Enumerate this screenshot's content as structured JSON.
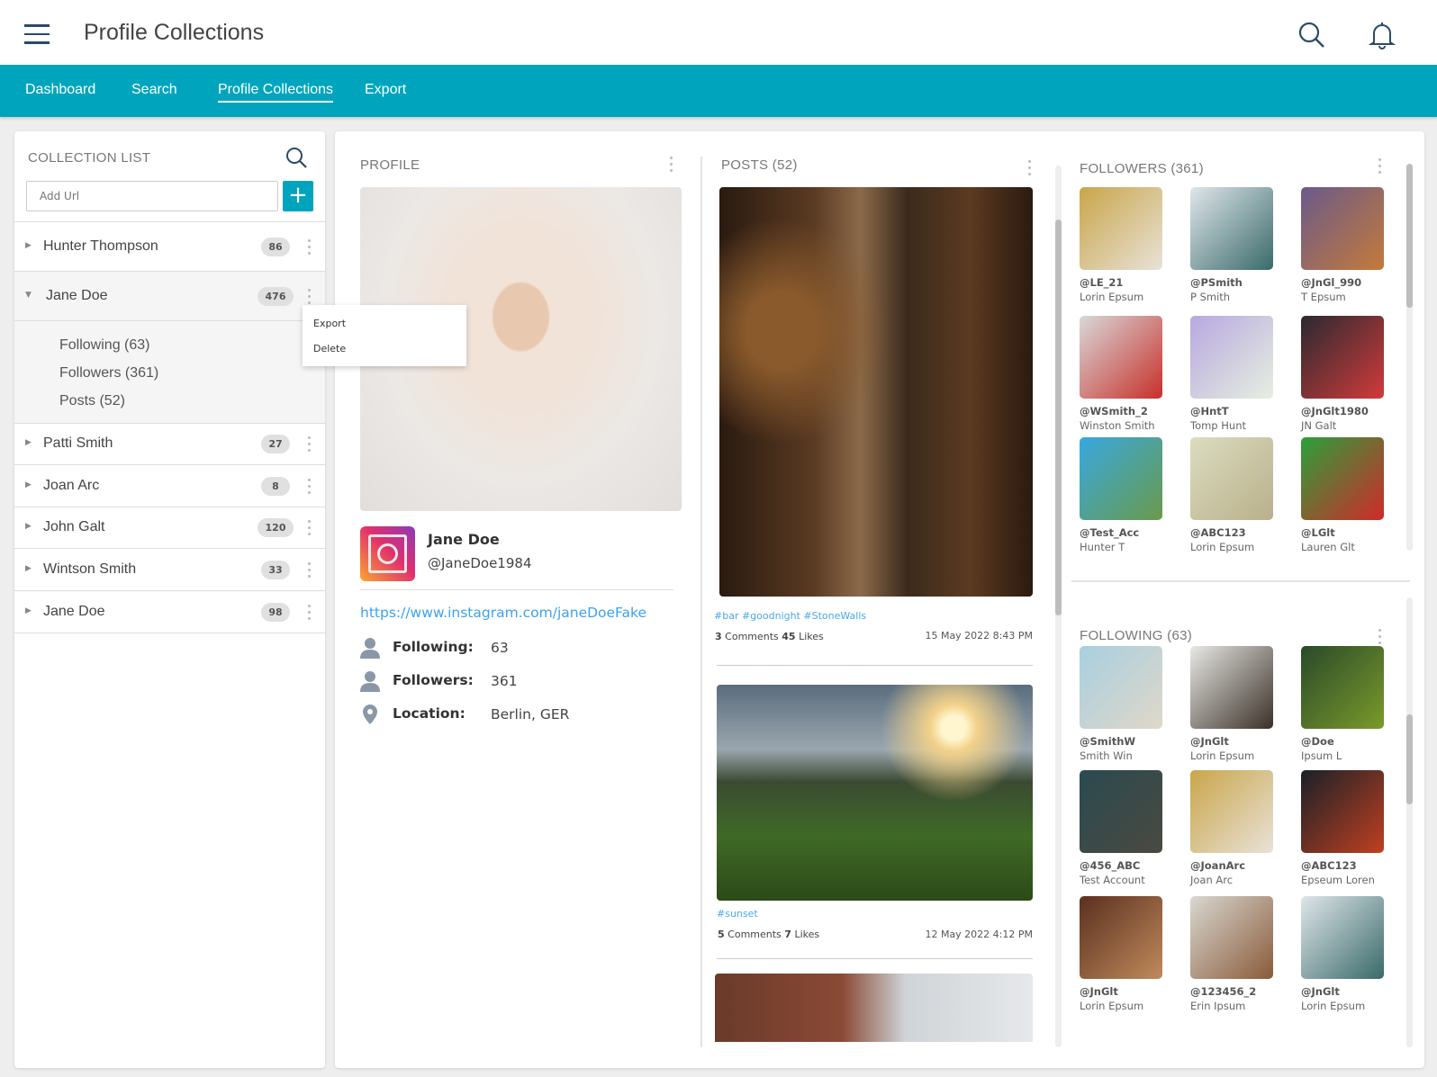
{
  "header": {
    "title": "Profile Collections",
    "menu_icon": "hamburger-icon",
    "search_icon": "search-icon",
    "bell_icon": "bell-icon"
  },
  "nav": {
    "items": [
      "Dashboard",
      "Search",
      "Profile Collections",
      "Export"
    ],
    "active": "Profile Collections"
  },
  "colors": {
    "accent": "#00a5bd",
    "link": "#2b9af3"
  },
  "collection_list": {
    "title": "COLLECTION LIST",
    "add_url_placeholder": "Add Url",
    "add_label": "+",
    "items": [
      {
        "name": "Hunter Thompson",
        "count": "86"
      },
      {
        "name": "Jane Doe",
        "count": "476",
        "expanded": true,
        "children": [
          "Following (63)",
          "Followers (361)",
          "Posts (52)"
        ]
      },
      {
        "name": "Patti Smith",
        "count": "27"
      },
      {
        "name": "Joan Arc",
        "count": "8"
      },
      {
        "name": "John Galt",
        "count": "120"
      },
      {
        "name": "Wintson Smith",
        "count": "33"
      },
      {
        "name": "Jane Doe",
        "count": "98"
      }
    ],
    "context_menu": [
      "Export",
      "Delete"
    ]
  },
  "profile": {
    "title": "PROFILE",
    "name": "Jane Doe",
    "handle": "@JaneDoe1984",
    "url": "https://www.instagram.com/janeDoeFake",
    "following_label": "Following:",
    "following": "63",
    "followers_label": "Followers:",
    "followers": "361",
    "location_label": "Location:",
    "location": "Berlin, GER"
  },
  "posts": {
    "title": "POSTS (52)",
    "items": [
      {
        "tags": "#bar #goodnight #StoneWalls",
        "comments": "3",
        "comments_label": "Comments",
        "likes": "45",
        "likes_label": "Likes",
        "date": "15 May 2022 8:43 PM"
      },
      {
        "tags": "#sunset",
        "comments": "5",
        "comments_label": "Comments",
        "likes": "7",
        "likes_label": "Likes",
        "date": "12 May 2022 4:12 PM"
      }
    ]
  },
  "followers": {
    "title": "FOLLOWERS (361)",
    "items": [
      {
        "handle": "@LE_21",
        "name": "Lorin Epsum"
      },
      {
        "handle": "@PSmith",
        "name": "P Smith"
      },
      {
        "handle": "@JnGl_990",
        "name": "T Epsum"
      },
      {
        "handle": "@WSmith_2",
        "name": "Winston Smith"
      },
      {
        "handle": "@HntT",
        "name": "Tomp Hunt"
      },
      {
        "handle": "@JnGlt1980",
        "name": "JN Galt"
      },
      {
        "handle": "@Test_Acc",
        "name": "Hunter T"
      },
      {
        "handle": "@ABC123",
        "name": "Lorin Epsum"
      },
      {
        "handle": "@LGlt",
        "name": "Lauren Glt"
      }
    ]
  },
  "following": {
    "title": "FOLLOWING (63)",
    "items": [
      {
        "handle": "@SmithW",
        "name": "Smith Win"
      },
      {
        "handle": "@JnGlt",
        "name": "Lorin Epsum"
      },
      {
        "handle": "@Doe",
        "name": "Ipsum L"
      },
      {
        "handle": "@456_ABC",
        "name": "Test Account"
      },
      {
        "handle": "@JoanArc",
        "name": "Joan Arc"
      },
      {
        "handle": "@ABC123",
        "name": "Epseum Loren"
      },
      {
        "handle": "@JnGlt",
        "name": "Lorin Epsum"
      },
      {
        "handle": "@123456_2",
        "name": "Erin Ipsum"
      },
      {
        "handle": "@JnGlt",
        "name": "Lorin Epsum"
      }
    ]
  }
}
